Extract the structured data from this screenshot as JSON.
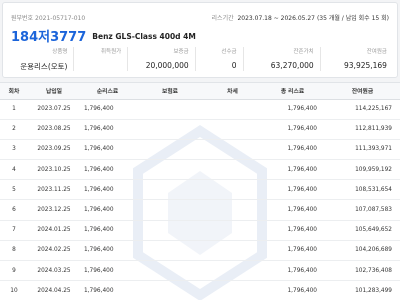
{
  "contract": {
    "label": "원부번호",
    "number": "2021-05717-010"
  },
  "period": {
    "label": "리스기간",
    "range": "2023.07.18 ~ 2026.05.27",
    "detail": "(35 개월 / 납입 회수 15 회)"
  },
  "vehicle": {
    "plate": "184저3777",
    "model": "Benz GLS-Class 400d 4M"
  },
  "summary": [
    {
      "label": "상품명",
      "value": "운용리스(오토)"
    },
    {
      "label": "취득원가",
      "value": ""
    },
    {
      "label": "보증금",
      "value": "20,000,000"
    },
    {
      "label": "선수금",
      "value": "0"
    },
    {
      "label": "잔존가치",
      "value": "63,270,000"
    },
    {
      "label": "잔여원금",
      "value": "93,925,169"
    }
  ],
  "table": {
    "headers": [
      "회차",
      "납입일",
      "순리스료",
      "보험료",
      "차세",
      "총 리스료",
      "잔여원금"
    ],
    "rows": [
      [
        "1",
        "2023.07.25",
        "1,796,400",
        "",
        "",
        "1,796,400",
        "114,225,167"
      ],
      [
        "2",
        "2023.08.25",
        "1,796,400",
        "",
        "",
        "1,796,400",
        "112,811,939"
      ],
      [
        "3",
        "2023.09.25",
        "1,796,400",
        "",
        "",
        "1,796,400",
        "111,393,971"
      ],
      [
        "4",
        "2023.10.25",
        "1,796,400",
        "",
        "",
        "1,796,400",
        "109,959,192"
      ],
      [
        "5",
        "2023.11.25",
        "1,796,400",
        "",
        "",
        "1,796,400",
        "108,531,654"
      ],
      [
        "6",
        "2023.12.25",
        "1,796,400",
        "",
        "",
        "1,796,400",
        "107,087,583"
      ],
      [
        "7",
        "2024.01.25",
        "1,796,400",
        "",
        "",
        "1,796,400",
        "105,649,652"
      ],
      [
        "8",
        "2024.02.25",
        "1,796,400",
        "",
        "",
        "1,796,400",
        "104,206,689"
      ],
      [
        "9",
        "2024.03.25",
        "1,796,400",
        "",
        "",
        "1,796,400",
        "102,736,408"
      ],
      [
        "10",
        "2024.04.25",
        "1,796,400",
        "",
        "",
        "1,796,400",
        "101,283,499"
      ]
    ]
  }
}
